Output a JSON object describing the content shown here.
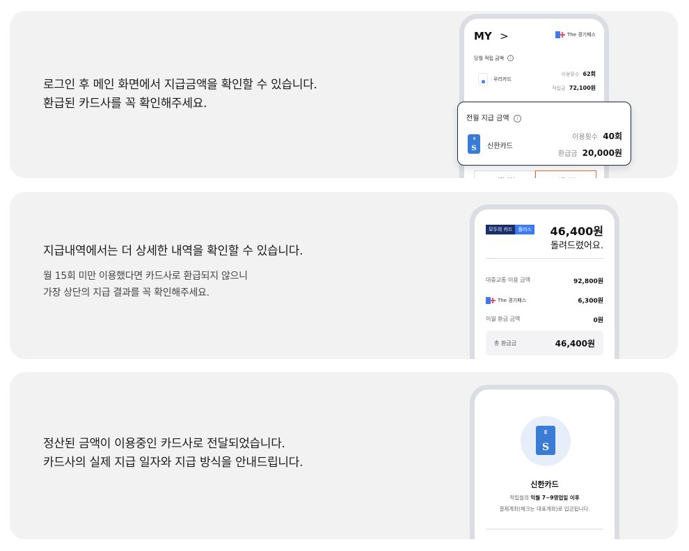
{
  "sections": [
    {
      "line1": "로그인 후 메인 화면에서 지급금액을 확인할 수 있습니다.",
      "line2": "환급된 카드사를 꼭 확인해주세요."
    },
    {
      "line1": "지급내역에서는 더 상세한 내역을 확인할 수 있습니다.",
      "sub1": "월 15회 미만 이용했다면 카드사로 환급되지 않으니",
      "sub2": "가장 상단의 지급 결과를 꼭 확인해주세요."
    },
    {
      "line1": "정산된 금액이 이용중인 카드사로 전달되었습니다.",
      "line2": "카드사의 실제 지급 일자와 지급 방식을 안내드립니다."
    }
  ],
  "phone1": {
    "my_label": "MY",
    "my_chevron": ">",
    "logo_text": "The 경기패스",
    "current_title": "당월 적립 금액",
    "card_name": "우리카드",
    "usage_label": "이용횟수",
    "usage_value": "62회",
    "accum_label": "적립금",
    "accum_value": "72,100원",
    "tab_left": "적립내역",
    "tab_right": "지급내역"
  },
  "popup": {
    "title": "전월 지급 금액",
    "card_name": "신한카드",
    "usage_label": "이용횟수",
    "usage_value": "40회",
    "refund_label": "환급금",
    "refund_value": "20,000원"
  },
  "phone2": {
    "badge_left": "모두의 카드",
    "badge_right": "플러스",
    "amount": "46,400원",
    "amount_sub": "돌려드렸어요.",
    "rows": [
      {
        "label": "대중교통 이용 금액",
        "value": "92,800원"
      },
      {
        "label": "The 경기패스",
        "value": "6,300원"
      },
      {
        "label": "이월 환급 금액",
        "value": "0원"
      }
    ],
    "total_label": "총 환급금",
    "total_value": "46,400원"
  },
  "phone3": {
    "card_name": "신한카드",
    "desc1_pre": "적립월의",
    "desc1_bold": "익월 7~9영업일 이후",
    "desc2": "결제계좌(체크는 대표계좌)로 입금됩니다."
  },
  "colors": {
    "panel_bg": "#f2f2f3",
    "card_blue": "#3a7bd5",
    "badge_navy": "#1a2e6c",
    "badge_blue": "#3b7cf6",
    "accent_orange": "#f26a2e",
    "popup_border": "#1a2a4a"
  }
}
